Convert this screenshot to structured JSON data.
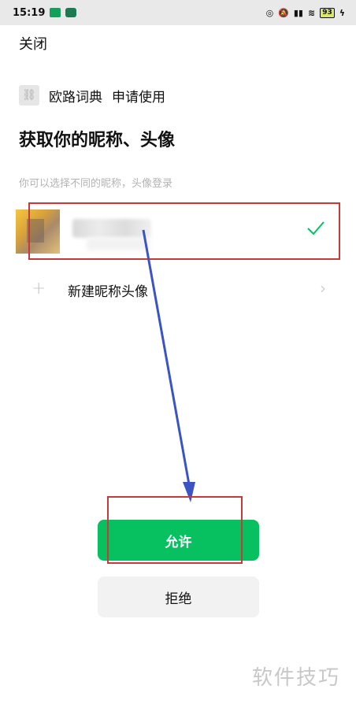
{
  "statusbar": {
    "time": "15:19",
    "battery": "93"
  },
  "header": {
    "close_label": "关闭"
  },
  "app": {
    "name": "欧路词典",
    "action": "申请使用",
    "logo_icon": "link-icon"
  },
  "title": "获取你的昵称、头像",
  "hint": "你可以选择不同的昵称，头像登录",
  "account": {
    "selected": true
  },
  "new_profile": {
    "label": "新建昵称头像"
  },
  "buttons": {
    "allow_label": "允许",
    "deny_label": "拒绝"
  },
  "watermark": "软件技巧",
  "colors": {
    "primary": "#07c160",
    "annotation": "#c73a3a",
    "arrow": "#3a54c4"
  }
}
